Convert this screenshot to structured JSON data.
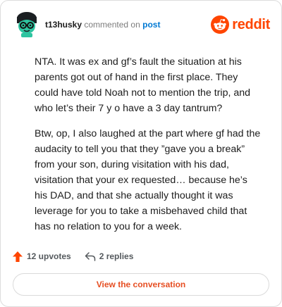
{
  "comment": {
    "username": "t13husky",
    "action_text": "commented on",
    "post_link": "post",
    "paragraphs": [
      "NTA. It was ex and gf’s fault the situation at his parents got out of hand in the first place. They could have told Noah not to mention the trip, and who let’s their 7 y o have a 3 day tantrum?",
      "Btw, op, I also laughed at the part where gf had the audacity to tell you that they ”gave you a break” from your son, during visitation with his dad, visitation that your ex requested… because he’s his DAD, and that she actually thought it was leverage for you to take a misbehaved child that has no relation to you for a week."
    ]
  },
  "brand": {
    "wordmark": "reddit",
    "color": "#ff4500",
    "icon": "reddit-snoo-icon"
  },
  "avatar": {
    "icon": "snoo-avatar-icon",
    "colors": {
      "face": "#2ec4a0",
      "hair": "#1b1f22",
      "glasses": "#111111"
    }
  },
  "actions": {
    "upvotes_label": "12 upvotes",
    "upvote_icon": "upvote-arrow-icon",
    "upvote_color": "#ff4500",
    "replies_label": "2 replies",
    "reply_icon": "reply-arrow-icon"
  },
  "cta": {
    "label": "View the conversation",
    "color": "#e64e22"
  }
}
